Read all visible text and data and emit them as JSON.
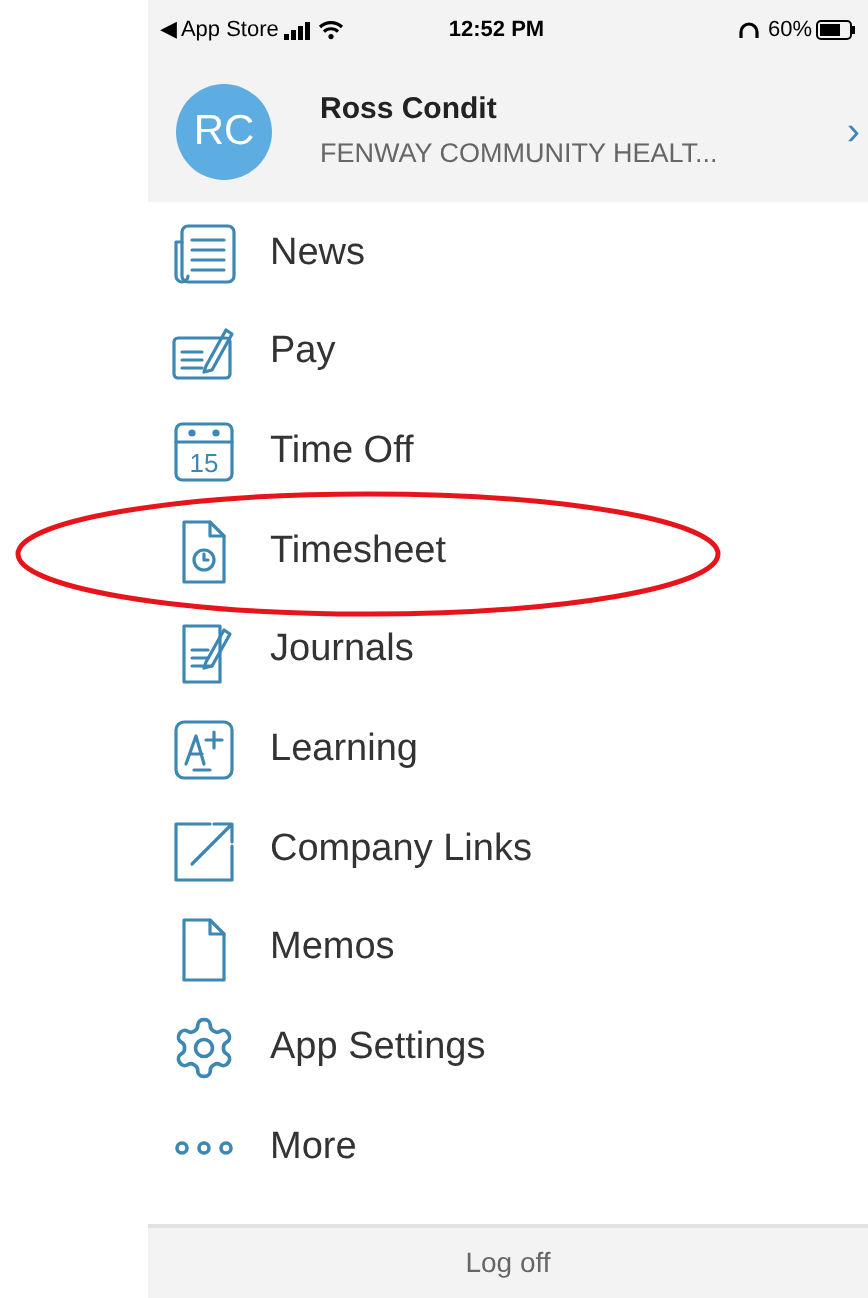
{
  "status_bar": {
    "back": "◀ App Store",
    "time": "12:52 PM",
    "battery": "60%"
  },
  "profile": {
    "initials": "RC",
    "name": "Ross Condit",
    "company": "FENWAY COMMUNITY HEALT...",
    "chevron": "›"
  },
  "menu": [
    {
      "label": "News",
      "kind": "news",
      "circled": false
    },
    {
      "label": "Pay",
      "kind": "pay",
      "circled": false
    },
    {
      "label": "Time Off",
      "kind": "calendar",
      "day": "15",
      "circled": false
    },
    {
      "label": "Timesheet",
      "kind": "timesheet",
      "circled": true
    },
    {
      "label": "Journals",
      "kind": "journal",
      "circled": false
    },
    {
      "label": "Learning",
      "kind": "learning",
      "circled": false
    },
    {
      "label": "Company Links",
      "kind": "link",
      "circled": false
    },
    {
      "label": "Memos",
      "kind": "memo",
      "circled": false
    },
    {
      "label": "App Settings",
      "kind": "settings",
      "circled": false
    },
    {
      "label": "More",
      "kind": "more",
      "circled": false
    }
  ],
  "footer": {
    "logoff": "Log off"
  }
}
